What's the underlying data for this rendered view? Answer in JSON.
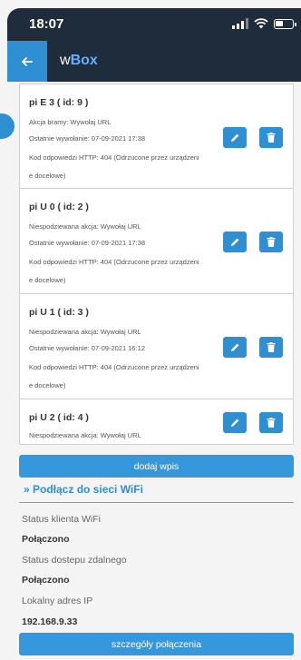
{
  "status_bar": {
    "time": "18:07"
  },
  "header": {
    "title_prefix": "w",
    "title_accent": "Box"
  },
  "entries": [
    {
      "title": "pi E 3 ( id: 9 )",
      "lines": [
        "Akcja bramy: Wywołaj URL",
        "Ostatnie wywołanie: 07-09-2021 17:38",
        "Kod odpowiedzi HTTP: 404 (Odrzucone przez urządzeni",
        "e docelowe)"
      ]
    },
    {
      "title": "pi U 0 ( id: 2 )",
      "lines": [
        "Niespodziewana akcja: Wywołaj URL",
        "Ostatnie wywołanie: 07-09-2021 17:38",
        "Kod odpowiedzi HTTP: 404 (Odrzucone przez urządzeni",
        "e docelowe)"
      ]
    },
    {
      "title": "pi U 1 ( id: 3 )",
      "lines": [
        "Niespodziewana akcja: Wywołaj URL",
        "Ostatnie wywołanie: 07-09-2021 16:12",
        "Kod odpowiedzi HTTP: 404 (Odrzucone przez urządzeni",
        "e docelowe)"
      ]
    },
    {
      "title": "pi U 2 ( id: 4 )",
      "lines": [
        "Niespodziewana akcja: Wywołaj URL"
      ]
    }
  ],
  "add_button": "dodaj wpis",
  "wifi_section": {
    "title": "» Podłącz do sieci WiFi",
    "client_status_label": "Status klienta WiFi",
    "client_status_value": "Połączono",
    "remote_status_label": "Status dostepu zdalnego",
    "remote_status_value": "Połączono",
    "ip_label": "Lokalny adres IP",
    "ip_value": "192.168.9.33"
  },
  "details_button": "szczegóły połączenia",
  "colors": {
    "accent": "#2f8fd1",
    "header_bg": "#1f2c3b"
  },
  "icons": {
    "back": "arrow-left-icon",
    "edit": "pencil-icon",
    "delete": "trash-icon"
  }
}
